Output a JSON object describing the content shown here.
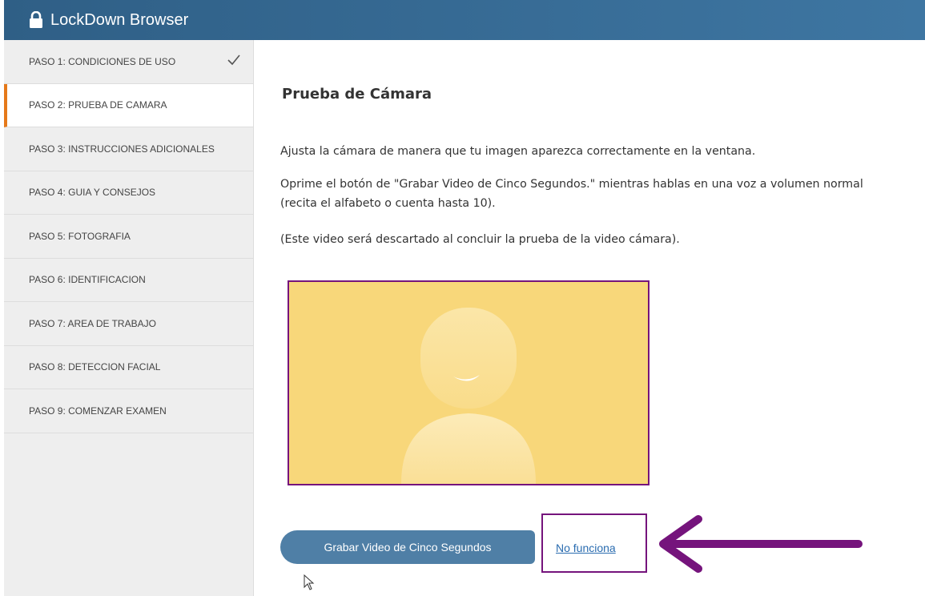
{
  "window": {
    "title": "LockDown Browser"
  },
  "sidebar": {
    "steps": [
      {
        "label": "PASO 1: CONDICIONES DE USO",
        "completed": true
      },
      {
        "label": "PASO 2: PRUEBA DE CAMARA",
        "active": true
      },
      {
        "label": "PASO 3: INSTRUCCIONES ADICIONALES"
      },
      {
        "label": "PASO 4: GUIA Y CONSEJOS"
      },
      {
        "label": "PASO 5: FOTOGRAFIA"
      },
      {
        "label": "PASO 6: IDENTIFICACION"
      },
      {
        "label": "PASO 7: AREA DE TRABAJO"
      },
      {
        "label": "PASO 8: DETECCION FACIAL"
      },
      {
        "label": "PASO 9: COMENZAR EXAMEN"
      }
    ]
  },
  "main": {
    "heading": "Prueba de Cámara",
    "paragraphs": [
      "Ajusta la cámara de manera que tu imagen aparezca correctamente en la ventana.",
      "Oprime el botón de \"Grabar Video de Cinco Segundos.\" mientras hablas en una voz a volumen normal (recita el alfabeto o cuenta hasta 10).",
      "(Este video será descartado al concluir la prueba de la video cámara)."
    ],
    "record_button_label": "Grabar Video de Cinco Segundos",
    "not_working_link": "No funciona"
  },
  "colors": {
    "titlebar": "#3e76a2",
    "active_step_accent": "#e5791a",
    "highlight": "#75147c",
    "camera_placeholder": "#f8d77a",
    "button": "#4f7fa6",
    "link": "#2a6cb0"
  },
  "icons": [
    "lock-icon",
    "check-icon",
    "avatar-placeholder",
    "arrow-icon",
    "mouse-cursor-icon"
  ]
}
